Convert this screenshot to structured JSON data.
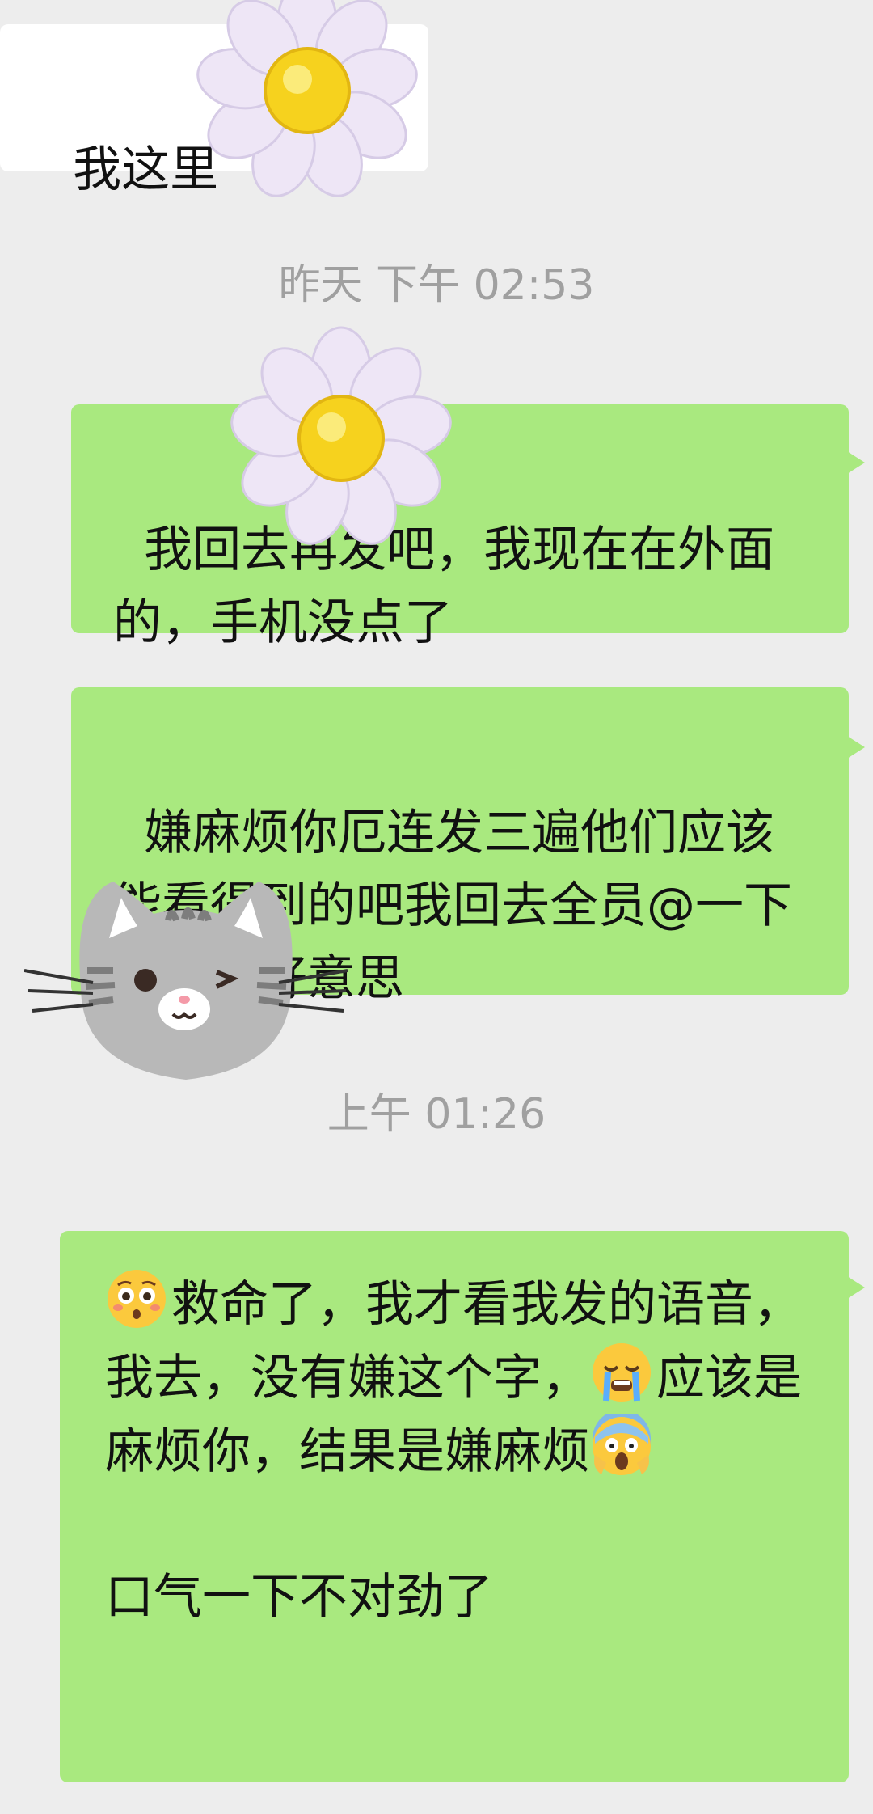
{
  "messages": [
    {
      "side": "received",
      "text": "我这里"
    },
    {
      "side": "system",
      "text": "昨天 下午 02:53"
    },
    {
      "side": "sent",
      "text": "我回去再发吧，我现在在外面的，手机没点了"
    },
    {
      "side": "sent",
      "text": "嫌麻烦你厄连发三遍他们应该能看得到的吧我回去全员@一下好吧不好意思"
    },
    {
      "side": "system",
      "text": "上午 01:26"
    },
    {
      "side": "sent",
      "parts": [
        {
          "emoji": "flushed-face"
        },
        {
          "text": "救命了，我才看我发的语音，我去，没有嫌这个字，"
        },
        {
          "emoji": "crying-face"
        },
        {
          "text": "应该是麻烦你，结果是嫌麻烦"
        },
        {
          "emoji": "screaming-face"
        },
        {
          "text": "\n\n口气一下不对劲了"
        }
      ]
    }
  ],
  "stickers": [
    "daisy-flower-sticker",
    "daisy-flower-sticker",
    "gray-cat-sticker"
  ],
  "colors": {
    "background": "#ededed",
    "sent_bubble": "#a9e97f",
    "received_bubble": "#ffffff",
    "timestamp_text": "#a0a0a0",
    "message_text": "#111111"
  }
}
